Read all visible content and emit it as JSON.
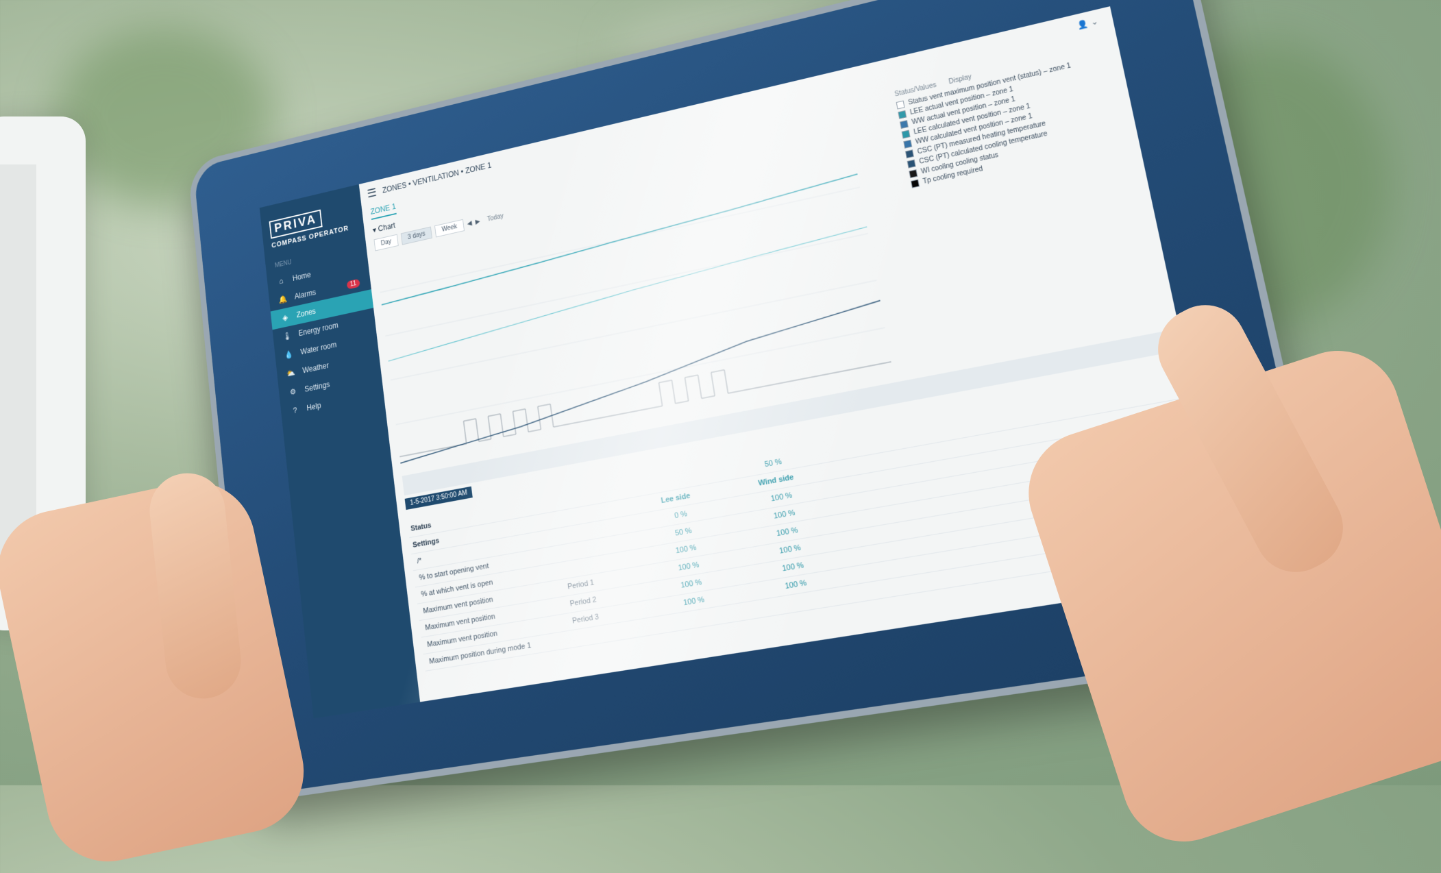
{
  "app": {
    "brand": "PRIVA",
    "brand_sub": "COMPASS OPERATOR",
    "breadcrumb": "ZONES • VENTILATION • ZONE 1",
    "user": "👤 ⌄"
  },
  "sidebar": {
    "caption": "MENU",
    "items": [
      {
        "label": "Home",
        "icon": "home-icon",
        "glyph": "⌂"
      },
      {
        "label": "Alarms",
        "icon": "bell-icon",
        "glyph": "🔔",
        "badge": "11"
      },
      {
        "label": "Zones",
        "icon": "zones-icon",
        "glyph": "◈"
      },
      {
        "label": "Energy room",
        "icon": "energy-icon",
        "glyph": "🌡"
      },
      {
        "label": "Water room",
        "icon": "water-icon",
        "glyph": "💧"
      },
      {
        "label": "Weather",
        "icon": "weather-icon",
        "glyph": "⛅"
      },
      {
        "label": "Settings",
        "icon": "gear-icon",
        "glyph": "⚙"
      },
      {
        "label": "Help",
        "icon": "help-icon",
        "glyph": "?"
      }
    ],
    "active_index": 2
  },
  "main": {
    "tab": "ZONE 1",
    "chart_section": "Chart",
    "toolbar": {
      "buttons": [
        "Day",
        "3 days",
        "Week"
      ],
      "selected": 1,
      "text": "Today"
    },
    "legend": {
      "head": [
        "Status/Values",
        "Display"
      ],
      "items": [
        {
          "label": "Status vent maximum position vent (status) – zone 1",
          "color": "#ffffff"
        },
        {
          "label": "LEE actual vent position – zone 1",
          "color": "#1c8fa1"
        },
        {
          "label": "WW actual vent position – zone 1",
          "color": "#2b6ca3"
        },
        {
          "label": "LEE calculated vent position – zone 1",
          "color": "#1c8fa1"
        },
        {
          "label": "WW calculated vent position – zone 1",
          "color": "#2b6ca3"
        },
        {
          "label": "CSC (PT) measured heating temperature",
          "color": "#1f4a6e"
        },
        {
          "label": "CSC (PT) calculated cooling temperature",
          "color": "#1f4a6e"
        },
        {
          "label": "WI cooling cooling status",
          "color": "#111111"
        },
        {
          "label": "Tp cooling required",
          "color": "#000000"
        }
      ]
    },
    "date_chip": "1-5-2017 3:50:00 AM",
    "status_label": "Status",
    "settings_label": "Settings",
    "table": {
      "col_lee": "Lee side",
      "col_wind": "Wind side",
      "rows": [
        {
          "label": "/*",
          "period": "",
          "lee": "0 %",
          "wind": "100 %"
        },
        {
          "label": "% to start opening vent",
          "period": "",
          "lee": "50 %",
          "wind": "100 %"
        },
        {
          "label": "% at which vent is open",
          "period": "",
          "lee": "100 %",
          "wind": "100 %"
        },
        {
          "label": "Maximum vent position",
          "period": "Period 1",
          "lee": "100 %",
          "wind": "100 %"
        },
        {
          "label": "Maximum vent position",
          "period": "Period 2",
          "lee": "100 %",
          "wind": "100 %"
        },
        {
          "label": "Maximum vent position",
          "period": "Period 3",
          "lee": "100 %",
          "wind": "100 %"
        },
        {
          "label": "Maximum position during mode 1",
          "period": "",
          "lee": "",
          "wind": ""
        }
      ],
      "status_value": "50 %"
    }
  }
}
